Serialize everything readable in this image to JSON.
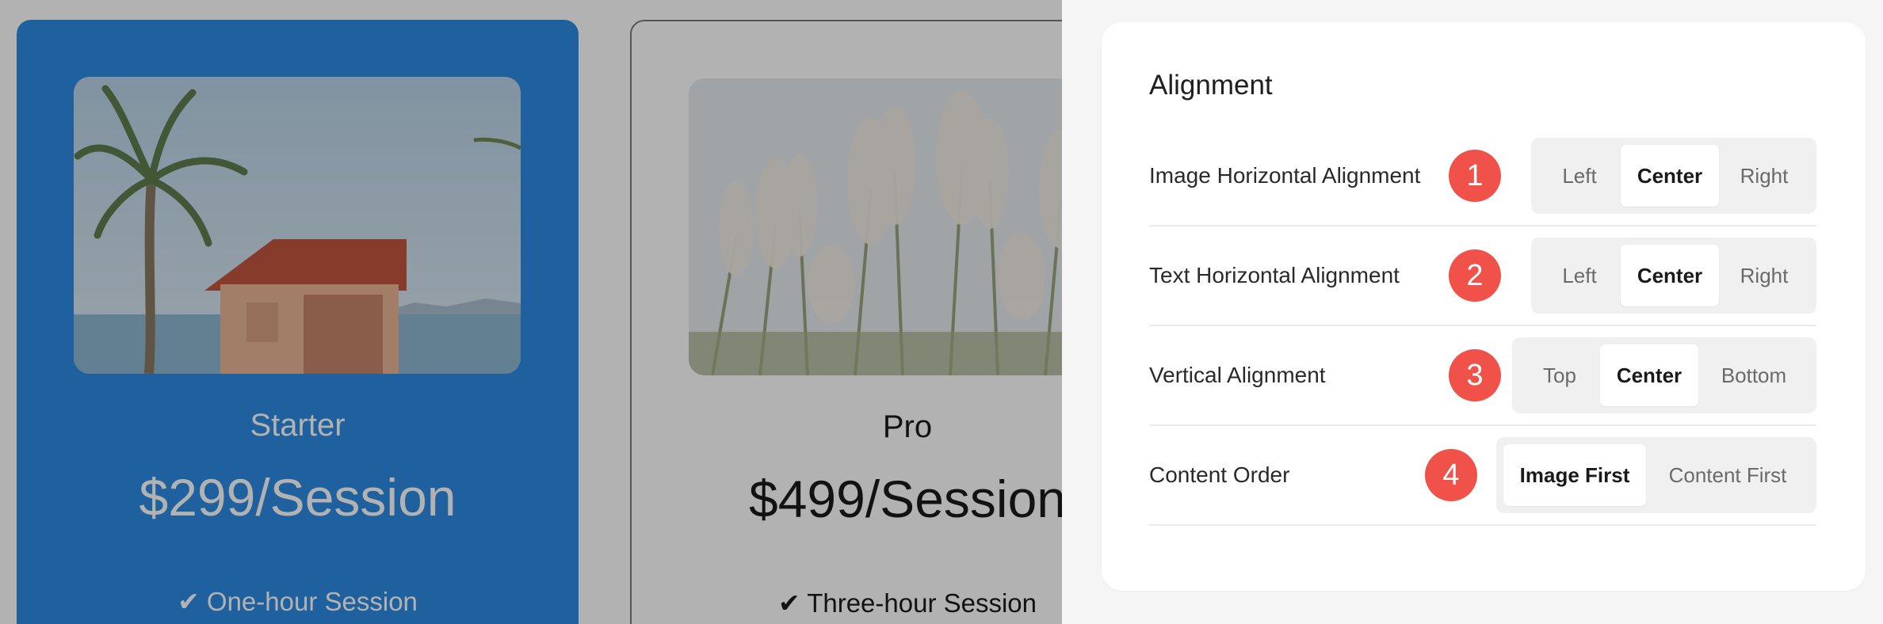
{
  "preview": {
    "cards": [
      {
        "title": "Starter",
        "price": "$299/Session",
        "feature": "✔ One-hour Session"
      },
      {
        "title": "Pro",
        "price": "$499/Session",
        "feature": "✔ Three-hour Session"
      }
    ]
  },
  "panel": {
    "title": "Alignment",
    "settings": [
      {
        "label": "Image Horizontal Alignment",
        "badge": "1",
        "options": [
          "Left",
          "Center",
          "Right"
        ],
        "selected": "Center"
      },
      {
        "label": "Text Horizontal Alignment",
        "badge": "2",
        "options": [
          "Left",
          "Center",
          "Right"
        ],
        "selected": "Center"
      },
      {
        "label": "Vertical Alignment",
        "badge": "3",
        "options": [
          "Top",
          "Center",
          "Bottom"
        ],
        "selected": "Center"
      },
      {
        "label": "Content Order",
        "badge": "4",
        "options": [
          "Image First",
          "Content First"
        ],
        "selected": "Image First"
      }
    ]
  },
  "colors": {
    "starter_card": "#2d8ce3",
    "badge": "#f0524a",
    "overlay": "rgba(0,0,0,0.30)"
  }
}
